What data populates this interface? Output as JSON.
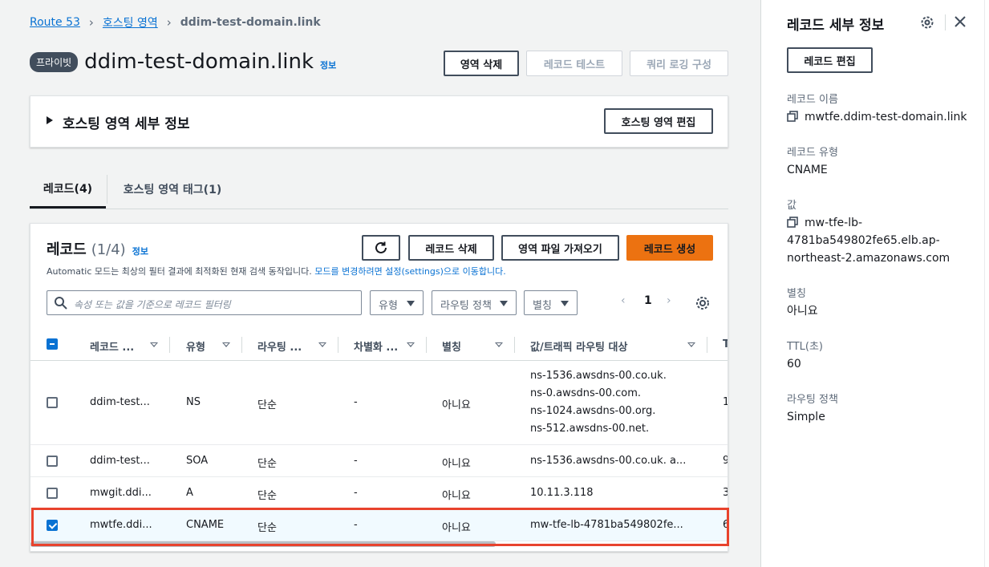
{
  "breadcrumb": {
    "root": "Route 53",
    "level1": "호스팅 영역",
    "current": "ddim-test-domain.link"
  },
  "header": {
    "badge": "프라이빗",
    "title": "ddim-test-domain.link",
    "info": "정보",
    "buttons": {
      "delete_zone": "영역 삭제",
      "test_record": "레코드 테스트",
      "query_logging": "쿼리 로깅 구성"
    }
  },
  "zone_details": {
    "title": "호스팅 영역 세부 정보",
    "edit": "호스팅 영역 편집"
  },
  "tabs": [
    {
      "label": "레코드(4)"
    },
    {
      "label": "호스팅 영역 태그(1)"
    }
  ],
  "records_panel": {
    "title": "레코드",
    "count": "(1/4)",
    "info": "정보",
    "desc": "Automatic 모드는 최상의 필터 결과에 최적화된 현재 검색 동작입니다. ",
    "desc_link": "모드를 변경하려면 설정(settings)으로 이동합니다.",
    "buttons": {
      "delete": "레코드 삭제",
      "import": "영역 파일 가져오기",
      "create": "레코드 생성"
    },
    "filter_placeholder": "속성 또는 값을 기준으로 레코드 필터링",
    "selects": {
      "type": "유형",
      "routing": "라우팅 정책",
      "alias": "별칭"
    },
    "page": "1",
    "columns": {
      "name": "레코드 ...",
      "type": "유형",
      "routing": "라우팅 ...",
      "diff": "차별화 ...",
      "alias": "별칭",
      "value": "값/트래픽 라우팅 대상",
      "ttl": "T"
    },
    "rows": [
      {
        "name": "ddim-test...",
        "type": "NS",
        "routing": "단순",
        "diff": "-",
        "alias": "아니요",
        "v1": "ns-1536.awsdns-00.co.uk.",
        "v2": "ns-0.awsdns-00.com.",
        "v3": "ns-1024.awsdns-00.org.",
        "v4": "ns-512.awsdns-00.net.",
        "ttl": "1"
      },
      {
        "name": "ddim-test...",
        "type": "SOA",
        "routing": "단순",
        "diff": "-",
        "alias": "아니요",
        "v1": "ns-1536.awsdns-00.co.uk. a...",
        "ttl": "9"
      },
      {
        "name": "mwgit.ddi...",
        "type": "A",
        "routing": "단순",
        "diff": "-",
        "alias": "아니요",
        "v1": "10.11.3.118",
        "ttl": "3"
      },
      {
        "name": "mwtfe.ddi...",
        "type": "CNAME",
        "routing": "단순",
        "diff": "-",
        "alias": "아니요",
        "v1": "mw-tfe-lb-4781ba549802fe...",
        "ttl": "6"
      }
    ]
  },
  "side_panel": {
    "title": "레코드 세부 정보",
    "edit": "레코드 편집",
    "record_name_label": "레코드 이름",
    "record_name": "mwtfe.ddim-test-domain.link",
    "record_type_label": "레코드 유형",
    "record_type": "CNAME",
    "value_label": "값",
    "value_line1": "mw-tfe-lb-",
    "value_line2": "4781ba549802fe65.elb.ap-",
    "value_line3": "northeast-2.amazonaws.com",
    "alias_label": "별칭",
    "alias": "아니요",
    "ttl_label": "TTL(초)",
    "ttl": "60",
    "routing_label": "라우팅 정책",
    "routing": "Simple"
  },
  "colors": {
    "primary": "#ec7211",
    "link": "#0972d3",
    "highlight": "#e8432d"
  }
}
